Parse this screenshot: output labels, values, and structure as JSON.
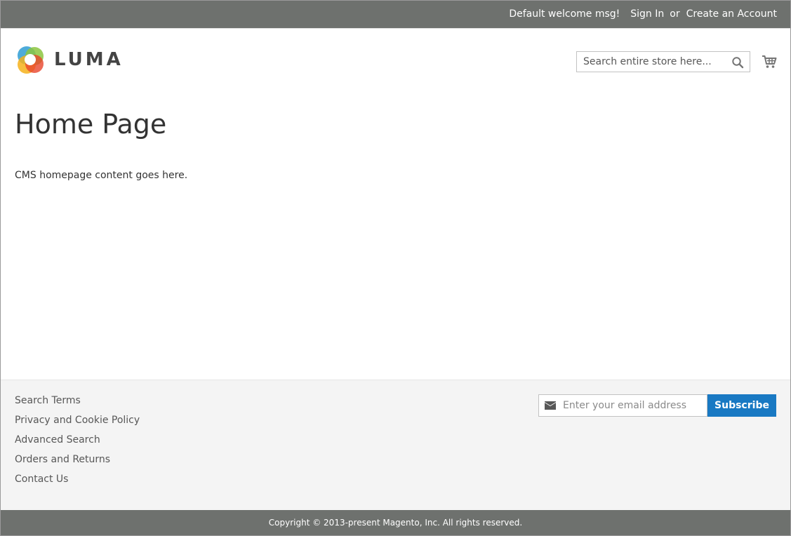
{
  "panel": {
    "welcome": "Default welcome msg!",
    "sign_in": "Sign In",
    "or": "or",
    "create_account": "Create an Account"
  },
  "header": {
    "logo_text": "LUMA",
    "search_placeholder": "Search entire store here...",
    "search_icon": "magnifier-icon",
    "cart_icon": "shopping-cart-icon"
  },
  "main": {
    "title": "Home Page",
    "content": "CMS homepage content goes here."
  },
  "footer": {
    "links": [
      "Search Terms",
      "Privacy and Cookie Policy",
      "Advanced Search",
      "Orders and Returns",
      "Contact Us"
    ],
    "newsletter": {
      "placeholder": "Enter your email address",
      "button": "Subscribe",
      "icon": "envelope-icon"
    },
    "copyright": "Copyright © 2013-present Magento, Inc. All rights reserved."
  },
  "colors": {
    "panel_bg": "#6e716e",
    "accent": "#1979c3",
    "footer_bg": "#f4f4f4",
    "text": "#333333"
  }
}
